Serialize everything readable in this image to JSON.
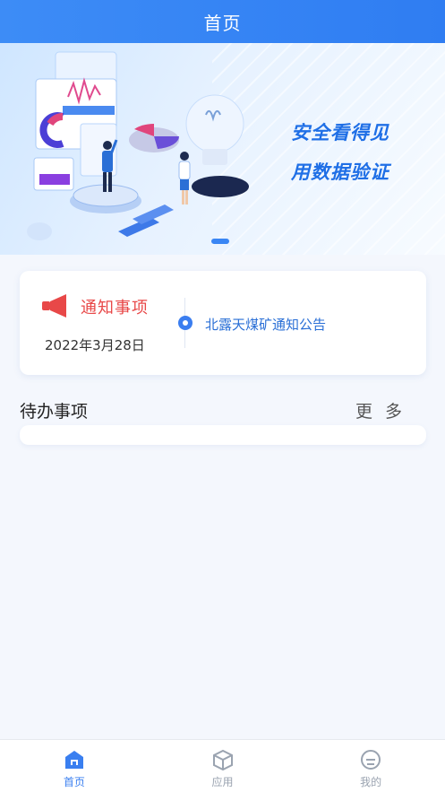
{
  "header": {
    "title": "首页"
  },
  "banner": {
    "slogan_line1": "安全看得见",
    "slogan_line2": "用数据验证"
  },
  "notice": {
    "label": "通知事项",
    "date": "2022年3月28日",
    "item": "北露天煤矿通知公告"
  },
  "todo": {
    "title": "待办事项",
    "more": "更 多"
  },
  "tabbar": {
    "tabs": [
      {
        "label": "首页",
        "icon": "home-icon",
        "active": true
      },
      {
        "label": "应用",
        "icon": "cube-icon",
        "active": false
      },
      {
        "label": "我的",
        "icon": "profile-icon",
        "active": false
      }
    ]
  },
  "colors": {
    "primary": "#2f7df2",
    "notice_red": "#e84848",
    "background": "#f4f7fd"
  }
}
